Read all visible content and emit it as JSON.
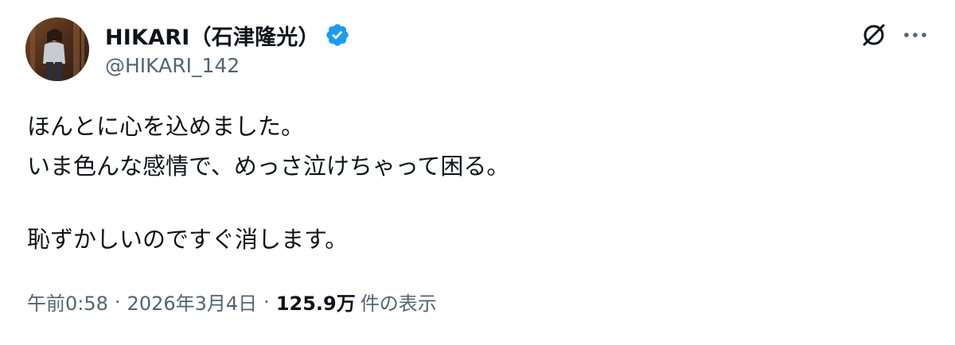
{
  "author": {
    "display_name": "HIKARI（石津隆光）",
    "handle": "@HIKARI_142",
    "verified": true,
    "verified_color": "#1d9bf0"
  },
  "tweet": {
    "lines": [
      "ほんとに心を込めました。",
      "いま色んな感情で、めっさ泣けちゃって困る。",
      "",
      "恥ずかしいのですぐ消します。"
    ]
  },
  "meta": {
    "time": "午前0:58",
    "separator": "·",
    "date": "2026年3月4日",
    "views_count": "125.9万",
    "views_label": "件の表示"
  },
  "icons": {
    "grok": "grok-icon",
    "more": "more-options-icon",
    "verified": "verified-badge-icon"
  },
  "colors": {
    "text_primary": "#0f1419",
    "text_secondary": "#536471",
    "accent": "#1d9bf0"
  }
}
